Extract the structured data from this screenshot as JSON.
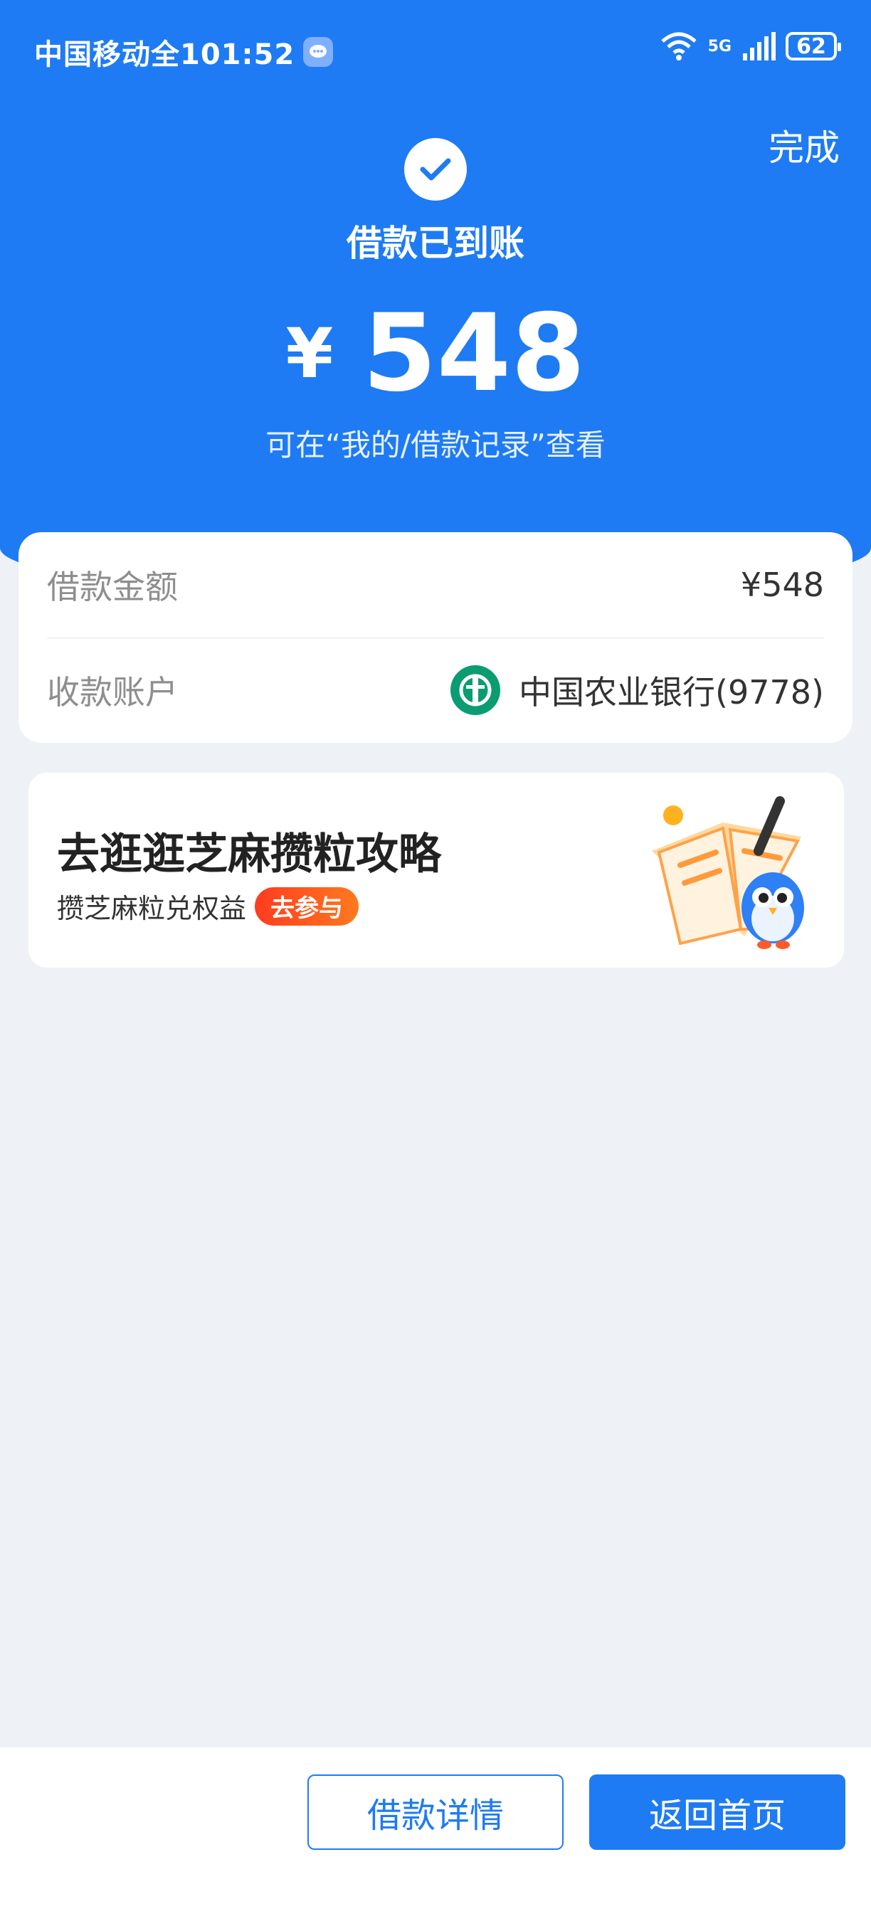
{
  "status": {
    "carrier_time": "中国移动全101:52",
    "battery": "62",
    "network": "5G"
  },
  "header": {
    "done_label": "完成",
    "title": "借款已到账",
    "currency": "¥",
    "amount": "548",
    "hint": "可在“我的/借款记录”查看"
  },
  "details": {
    "loan_amount_label": "借款金额",
    "loan_amount_value": "¥548",
    "account_label": "收款账户",
    "account_value": "中国农业银行(9778)"
  },
  "banner": {
    "title": "去逛逛芝麻攒粒攻略",
    "subtitle": "攒芝麻粒兑权益",
    "button": "去参与"
  },
  "footer": {
    "details_button": "借款详情",
    "home_button": "返回首页"
  },
  "colors": {
    "primary": "#1e7bf4",
    "background": "#eef2f7",
    "bank_green": "#0b9c72",
    "cta_orange": "#ff3b1f"
  },
  "icons": [
    "check-icon",
    "message-icon",
    "wifi-icon",
    "signal-icon",
    "battery-icon",
    "abc-bank-logo-icon",
    "owl-mascot-icon"
  ]
}
